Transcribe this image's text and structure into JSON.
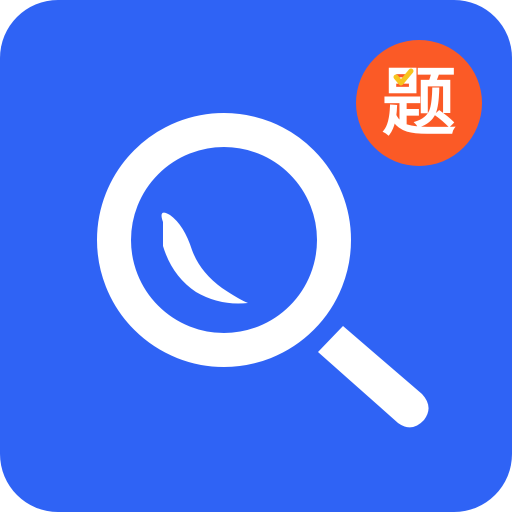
{
  "app_icon": {
    "name": "search-questions-app-icon",
    "tile_color": "#2f63f5",
    "glyph_color": "#ffffff",
    "main_icon": "magnifying-glass-icon",
    "badge": {
      "text": "题",
      "background_color": "#fb5a26",
      "text_color": "#ffffff",
      "checkmark_color": "#f7c51e",
      "checkmark_icon": "checkmark-icon"
    }
  }
}
